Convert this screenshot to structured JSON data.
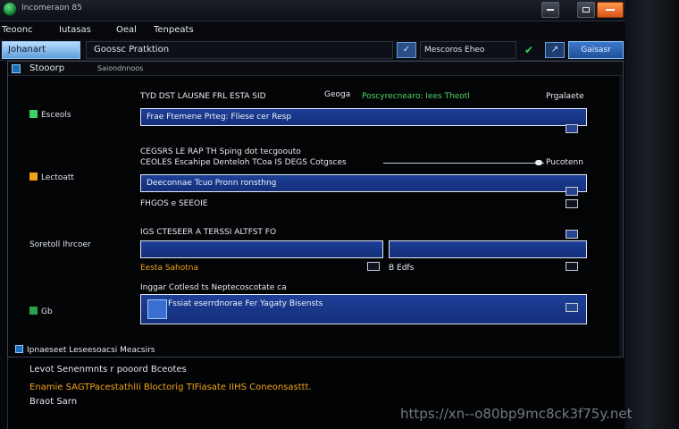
{
  "window": {
    "title": "Incomeraon 85",
    "accent": "#1d3f98"
  },
  "menu": [
    "Teoonc",
    "Iutasas",
    "Oeal",
    "Tenpeats"
  ],
  "nav": {
    "tab": "Johanart",
    "path": "Goossc Pratktion",
    "go_icon": "check-icon",
    "search": "Mescoros Eheo",
    "help": "Gaisasr"
  },
  "panel": {
    "title": "Stooorp",
    "subtitle": "Saiondnnoos"
  },
  "rows": [
    {
      "label": "Esceols",
      "icon_color": "#3fd064",
      "caption": "TYD DST LAUSNE FRL ESTA SID",
      "caption_mid": "Geoga",
      "caption_green": "Poscyrecnearo: Iees Theotl",
      "caption_right": "Prgalaete",
      "field": "Frae Ftemene Prteg: Fliese cer Resp"
    },
    {
      "label": "Lectoatt",
      "icon_color": "#f2a21a",
      "caption": "CEGSRS LE RAP TH Sping dot tecgoouto",
      "caption2": "CEOLES Escahipe Denteloh TCoa IS DEGS Cotgsces",
      "caption_right": "Pucotenn",
      "field": "Deeconnae Tcuo Pronn ronsthng",
      "below": "FHGOS e SEEOIE"
    },
    {
      "label": "Soretoll Ihrcoer",
      "caption": "IGS CTESEER A TERSSI ALTFST FO",
      "field": "",
      "below_left": "Eesta Sahotna",
      "below_right": "B Edfs"
    },
    {
      "label": "Gb",
      "icon_color": "#2fa04a",
      "caption": "Inggar Cotlesd ts Neptecoscotate ca",
      "field": "Fssiat eserrdnorae Fer Yagaty Bisensts"
    }
  ],
  "status": {
    "section": "Ipnaeseet Leseesoacsi Meacsirs",
    "line1": "Levot Senenmnts r pooord Bceotes",
    "line2": "Enamie SAGTPacestathlIi Bloctorig TIFiasate IIHS Coneonsasttt.",
    "line3": "Braot Sarn"
  },
  "watermark": "https://xn--o80bp9mc8ck3f75y.net"
}
